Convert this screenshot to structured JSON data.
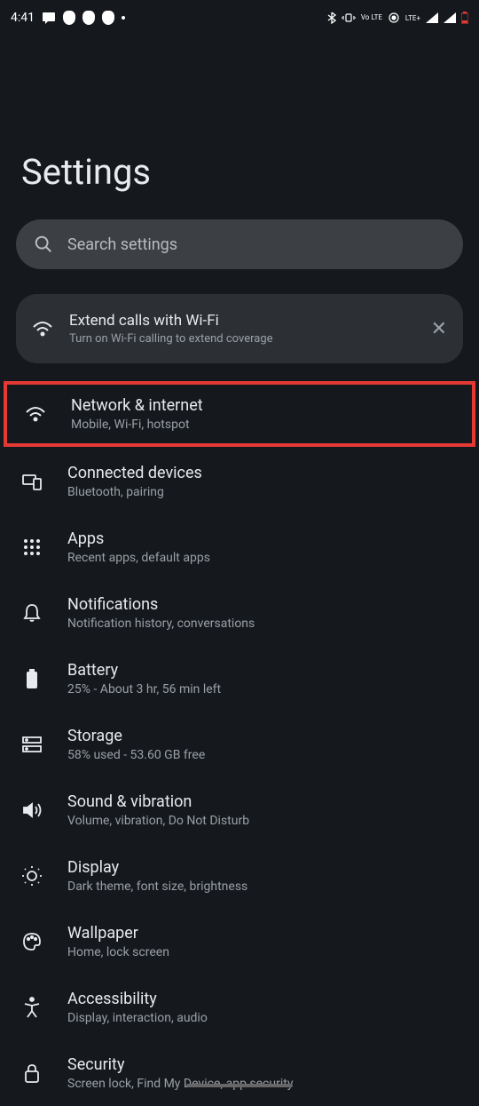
{
  "statusBar": {
    "time": "4:41",
    "lteLabel": "LTE+",
    "voLteLabel": "Vo LTE"
  },
  "page": {
    "title": "Settings"
  },
  "search": {
    "placeholder": "Search settings"
  },
  "promo": {
    "title": "Extend calls with Wi-Fi",
    "subtitle": "Turn on Wi-Fi calling to extend coverage"
  },
  "items": [
    {
      "title": "Network & internet",
      "subtitle": "Mobile, Wi-Fi, hotspot"
    },
    {
      "title": "Connected devices",
      "subtitle": "Bluetooth, pairing"
    },
    {
      "title": "Apps",
      "subtitle": "Recent apps, default apps"
    },
    {
      "title": "Notifications",
      "subtitle": "Notification history, conversations"
    },
    {
      "title": "Battery",
      "subtitle": "25% - About 3 hr, 56 min left"
    },
    {
      "title": "Storage",
      "subtitle": "58% used - 53.60 GB free"
    },
    {
      "title": "Sound & vibration",
      "subtitle": "Volume, vibration, Do Not Disturb"
    },
    {
      "title": "Display",
      "subtitle": "Dark theme, font size, brightness"
    },
    {
      "title": "Wallpaper",
      "subtitle": "Home, lock screen"
    },
    {
      "title": "Accessibility",
      "subtitle": "Display, interaction, audio"
    },
    {
      "title": "Security",
      "subtitle": "Screen lock, Find My Device, app security"
    }
  ]
}
